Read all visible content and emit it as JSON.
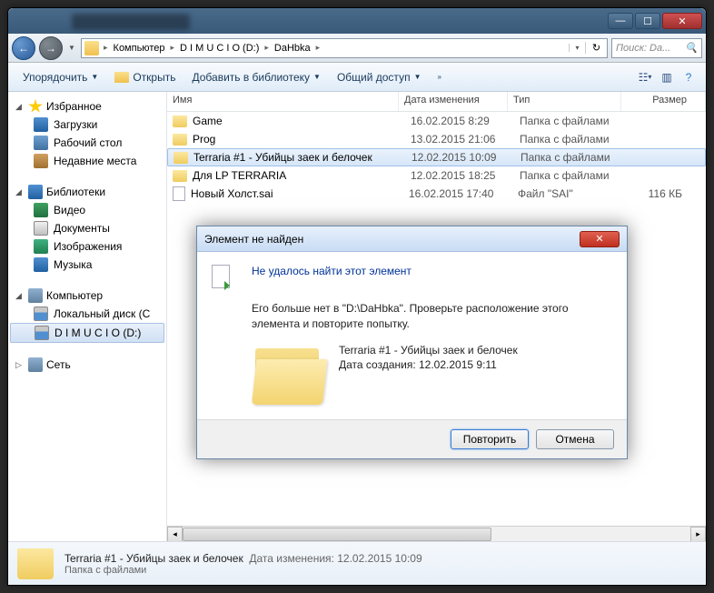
{
  "titlebar": {
    "min": "—",
    "max": "☐",
    "close": "✕"
  },
  "nav": {
    "path": [
      "Компьютер",
      "D I M U C I O (D:)",
      "DaHbka"
    ],
    "search_placeholder": "Поиск: Da..."
  },
  "toolbar": {
    "organize": "Упорядочить",
    "open": "Открыть",
    "add_library": "Добавить в библиотеку",
    "share": "Общий доступ",
    "help": "?"
  },
  "sidebar": {
    "favorites": {
      "label": "Избранное",
      "items": [
        "Загрузки",
        "Рабочий стол",
        "Недавние места"
      ]
    },
    "libraries": {
      "label": "Библиотеки",
      "items": [
        "Видео",
        "Документы",
        "Изображения",
        "Музыка"
      ]
    },
    "computer": {
      "label": "Компьютер",
      "items": [
        "Локальный диск (C",
        "D I M U C I O (D:)"
      ]
    },
    "network": {
      "label": "Сеть"
    }
  },
  "columns": {
    "name": "Имя",
    "date": "Дата изменения",
    "type": "Тип",
    "size": "Размер"
  },
  "files": [
    {
      "name": "Game",
      "date": "16.02.2015 8:29",
      "type": "Папка с файлами",
      "size": "",
      "kind": "folder"
    },
    {
      "name": "Prog",
      "date": "13.02.2015 21:06",
      "type": "Папка с файлами",
      "size": "",
      "kind": "folder"
    },
    {
      "name": "Terraria #1 - Убийцы заек и белочек",
      "date": "12.02.2015 10:09",
      "type": "Папка с файлами",
      "size": "",
      "kind": "folder",
      "selected": true
    },
    {
      "name": "Для LP TERRARIA",
      "date": "12.02.2015 18:25",
      "type": "Папка с файлами",
      "size": "",
      "kind": "folder"
    },
    {
      "name": "Новый Холст.sai",
      "date": "16.02.2015 17:40",
      "type": "Файл \"SAI\"",
      "size": "116 КБ",
      "kind": "file"
    }
  ],
  "status": {
    "name": "Terraria #1 - Убийцы заек и белочек",
    "type": "Папка с файлами",
    "date_label": "Дата изменения:",
    "date": "12.02.2015 10:09"
  },
  "dialog": {
    "title": "Элемент не найден",
    "heading": "Не удалось найти этот элемент",
    "body": "Его больше нет в \"D:\\DaHbka\". Проверьте расположение этого элемента и повторите попытку.",
    "item_name": "Terraria #1 - Убийцы заек и белочек",
    "created_label": "Дата создания:",
    "created": "12.02.2015 9:11",
    "retry": "Повторить",
    "cancel": "Отмена",
    "close": "✕"
  }
}
